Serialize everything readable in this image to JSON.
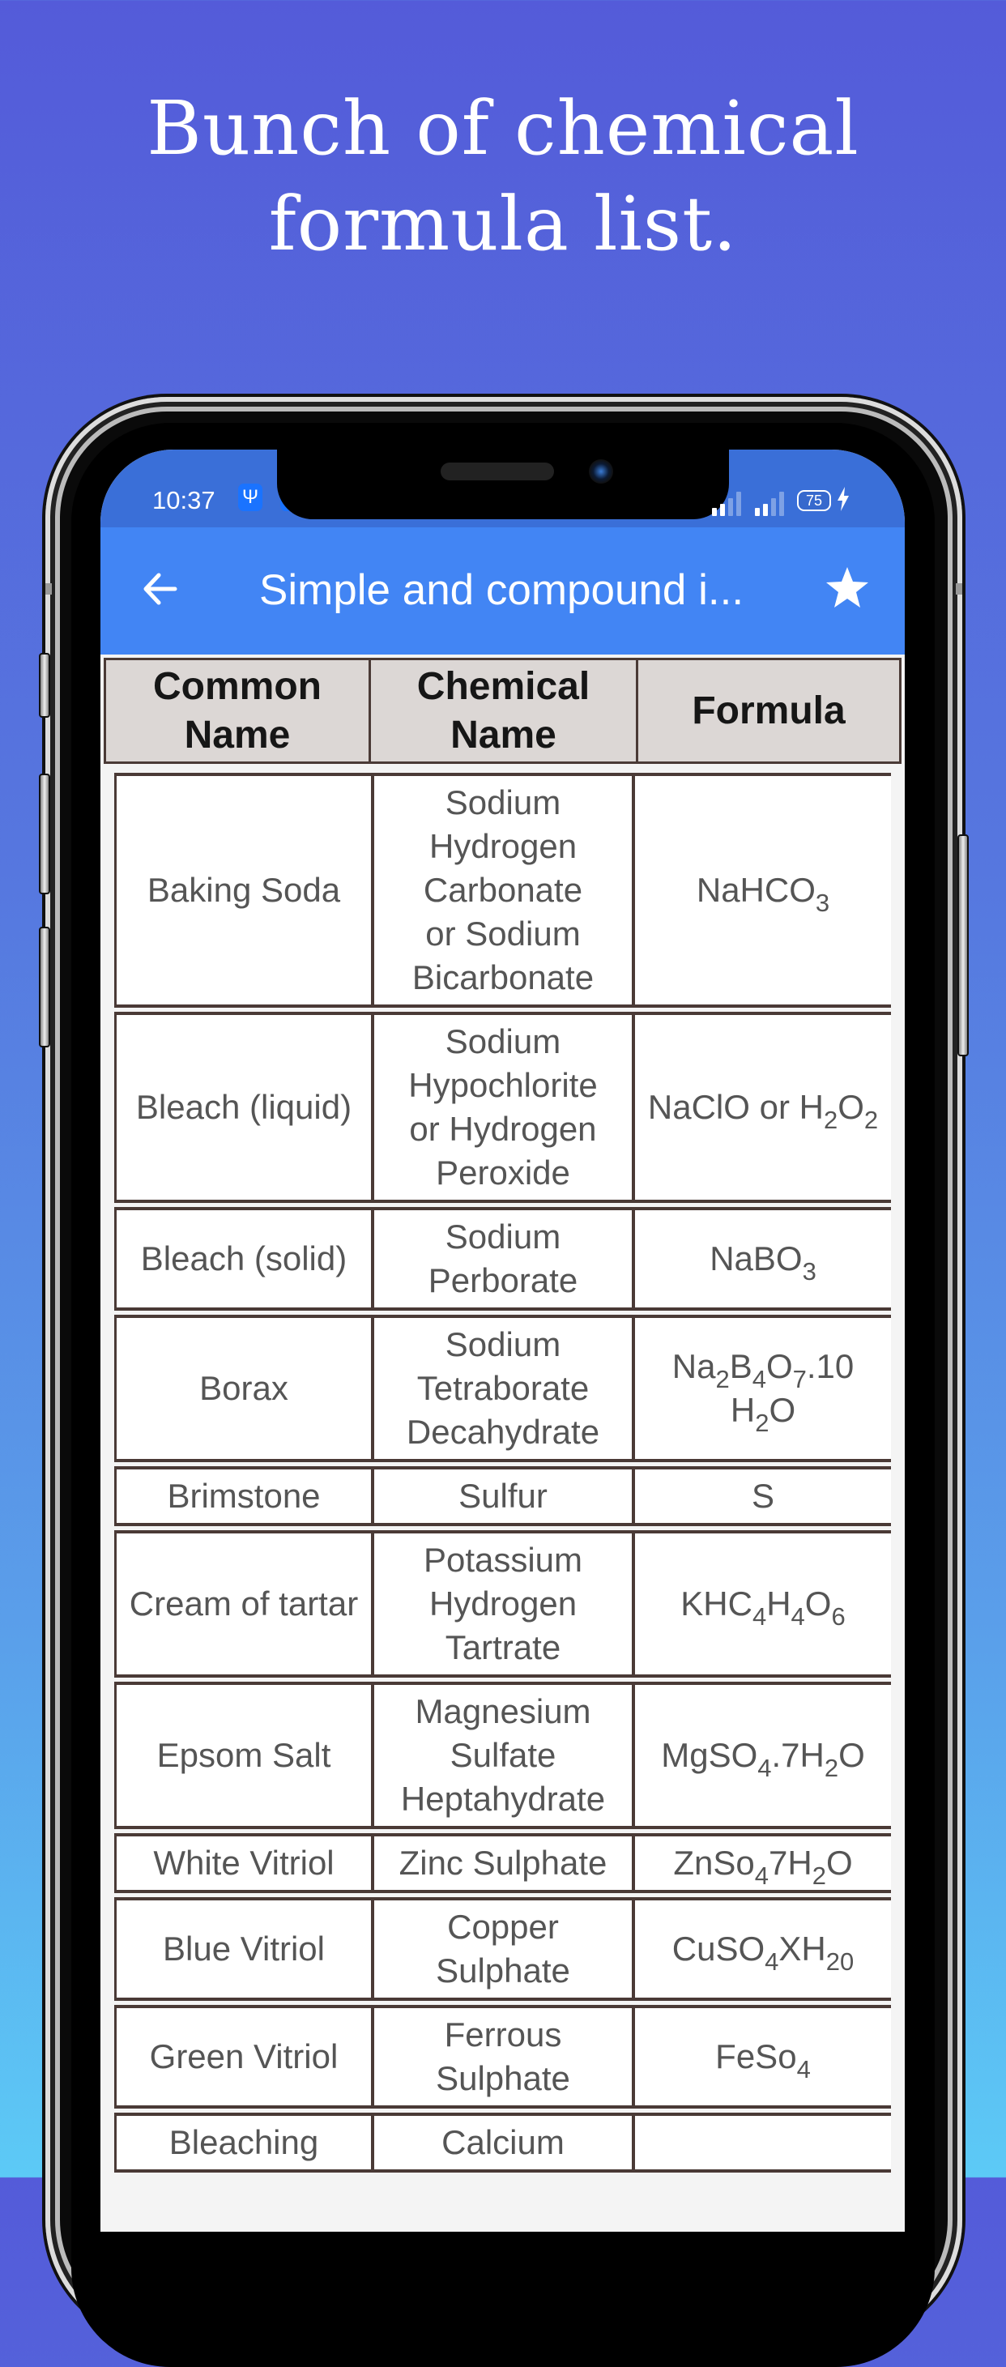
{
  "promo": {
    "headline_line1": "Bunch of chemical",
    "headline_line2": "formula list."
  },
  "status_bar": {
    "time": "10:37",
    "usb_icon": "usb-icon",
    "battery_level": "75",
    "charging": true
  },
  "app_bar": {
    "title": "Simple and compound i...",
    "back_icon": "arrow-left-icon",
    "favorite_icon": "star-icon"
  },
  "colors": {
    "status_bar": "#3a6fd8",
    "app_bar": "#4285f4",
    "header_bg": "#dcd7d5",
    "border": "#4a3a36"
  },
  "table": {
    "headers": [
      "Common\nName",
      "Chemical\nName",
      "Formula"
    ],
    "rows": [
      {
        "common": "Baking Soda",
        "chemical": "Sodium\nHydrogen\nCarbonate\nor Sodium\nBicarbonate",
        "formula": [
          [
            "NaHCO",
            ""
          ],
          [
            "3",
            "sub"
          ]
        ]
      },
      {
        "common": "Bleach (liquid)",
        "chemical": "Sodium\nHypochlorite\nor Hydrogen\nPeroxide",
        "formula": [
          [
            "NaClO or H",
            ""
          ],
          [
            "2",
            "sub"
          ],
          [
            "O",
            ""
          ],
          [
            "2",
            "sub"
          ]
        ]
      },
      {
        "common": "Bleach (solid)",
        "chemical": "Sodium\nPerborate",
        "formula": [
          [
            "NaBO",
            ""
          ],
          [
            "3",
            "sub"
          ]
        ]
      },
      {
        "common": "Borax",
        "chemical": "Sodium\nTetraborate\nDecahydrate",
        "formula": [
          [
            "Na",
            ""
          ],
          [
            "2",
            "sub"
          ],
          [
            "B",
            ""
          ],
          [
            "4",
            "sub"
          ],
          [
            "O",
            ""
          ],
          [
            "7",
            "sub"
          ],
          [
            ".10 H",
            ""
          ],
          [
            "2",
            "sub"
          ],
          [
            "O",
            ""
          ]
        ]
      },
      {
        "common": "Brimstone",
        "chemical": "Sulfur",
        "formula": [
          [
            "S",
            ""
          ]
        ]
      },
      {
        "common": "Cream of tartar",
        "chemical": "Potassium\nHydrogen\nTartrate",
        "formula": [
          [
            "KHC",
            ""
          ],
          [
            "4",
            "sub"
          ],
          [
            "H",
            ""
          ],
          [
            "4",
            "sub"
          ],
          [
            "O",
            ""
          ],
          [
            "6",
            "sub"
          ]
        ]
      },
      {
        "common": "Epsom Salt",
        "chemical": "Magnesium\nSulfate\nHeptahydrate",
        "formula": [
          [
            "MgSO",
            ""
          ],
          [
            "4",
            "sub"
          ],
          [
            ".7H",
            ""
          ],
          [
            "2",
            "sub"
          ],
          [
            "O",
            ""
          ]
        ]
      },
      {
        "common": "White Vitriol",
        "chemical": "Zinc Sulphate",
        "formula": [
          [
            "ZnSo",
            ""
          ],
          [
            "4",
            "sub"
          ],
          [
            "7H",
            ""
          ],
          [
            "2",
            "sub"
          ],
          [
            "O",
            ""
          ]
        ]
      },
      {
        "common": "Blue Vitriol",
        "chemical": "Copper\nSulphate",
        "formula": [
          [
            "CuSO",
            ""
          ],
          [
            "4",
            "sub"
          ],
          [
            "XH",
            ""
          ],
          [
            "20",
            "sub"
          ]
        ]
      },
      {
        "common": "Green Vitriol",
        "chemical": "Ferrous\nSulphate",
        "formula": [
          [
            "FeSo",
            ""
          ],
          [
            "4",
            "sub"
          ]
        ]
      },
      {
        "common": "Bleaching",
        "chemical": "Calcium",
        "formula": [
          [
            "",
            ""
          ]
        ]
      }
    ]
  }
}
